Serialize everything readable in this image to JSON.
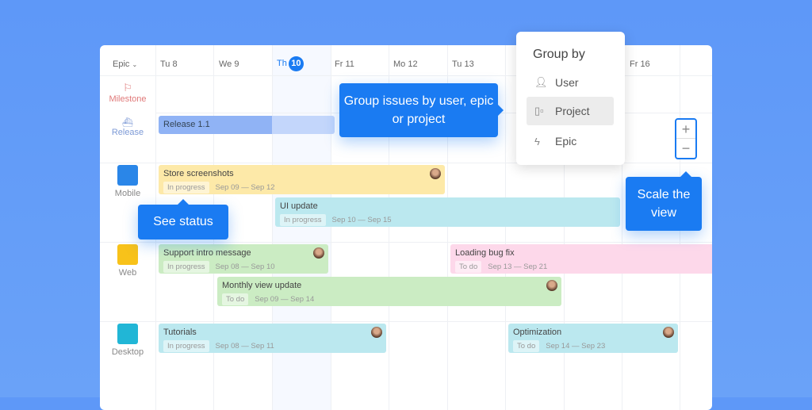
{
  "header": {
    "group_select": "Epic",
    "days": [
      {
        "label": "Tu 8"
      },
      {
        "label": "We 9"
      },
      {
        "label": "Th",
        "num": "10"
      },
      {
        "label": "Fr 11"
      },
      {
        "label": "Mo 12"
      },
      {
        "label": "Tu 13"
      },
      {
        "label": "Fr 16"
      }
    ]
  },
  "rows": {
    "milestone": "Milestone",
    "release": "Release",
    "mobile": "Mobile",
    "web": "Web",
    "desktop": "Desktop"
  },
  "release_bar": "Release 1.1",
  "tasks": [
    {
      "title": "Store screenshots",
      "status": "In progress",
      "dates": "Sep 09 — Sep 12",
      "color": "#fde9a8"
    },
    {
      "title": "UI update",
      "status": "In progress",
      "dates": "Sep 10 — Sep 15",
      "color": "#bbe8ef"
    },
    {
      "title": "Support intro message",
      "status": "In progress",
      "dates": "Sep 08 — Sep 10",
      "color": "#cbecc3"
    },
    {
      "title": "Loading bug fix",
      "status": "To do",
      "dates": "Sep 13 — Sep 21",
      "color": "#fdd8ea"
    },
    {
      "title": "Monthly view update",
      "status": "To do",
      "dates": "Sep 09 — Sep 14",
      "color": "#cbecc3"
    },
    {
      "title": "Tutorials",
      "status": "In progress",
      "dates": "Sep 08 — Sep 11",
      "color": "#bbe8ef"
    },
    {
      "title": "Optimization",
      "status": "To do",
      "dates": "Sep 14 — Sep 23",
      "color": "#bbe8ef"
    }
  ],
  "tooltips": {
    "group": "Group issues by user, epic or project",
    "status": "See status",
    "scale": "Scale the view"
  },
  "group_by": {
    "title": "Group by",
    "items": [
      "User",
      "Project",
      "Epic"
    ],
    "selected": "Project"
  },
  "zoom": {
    "plus": "+",
    "minus": "−"
  }
}
